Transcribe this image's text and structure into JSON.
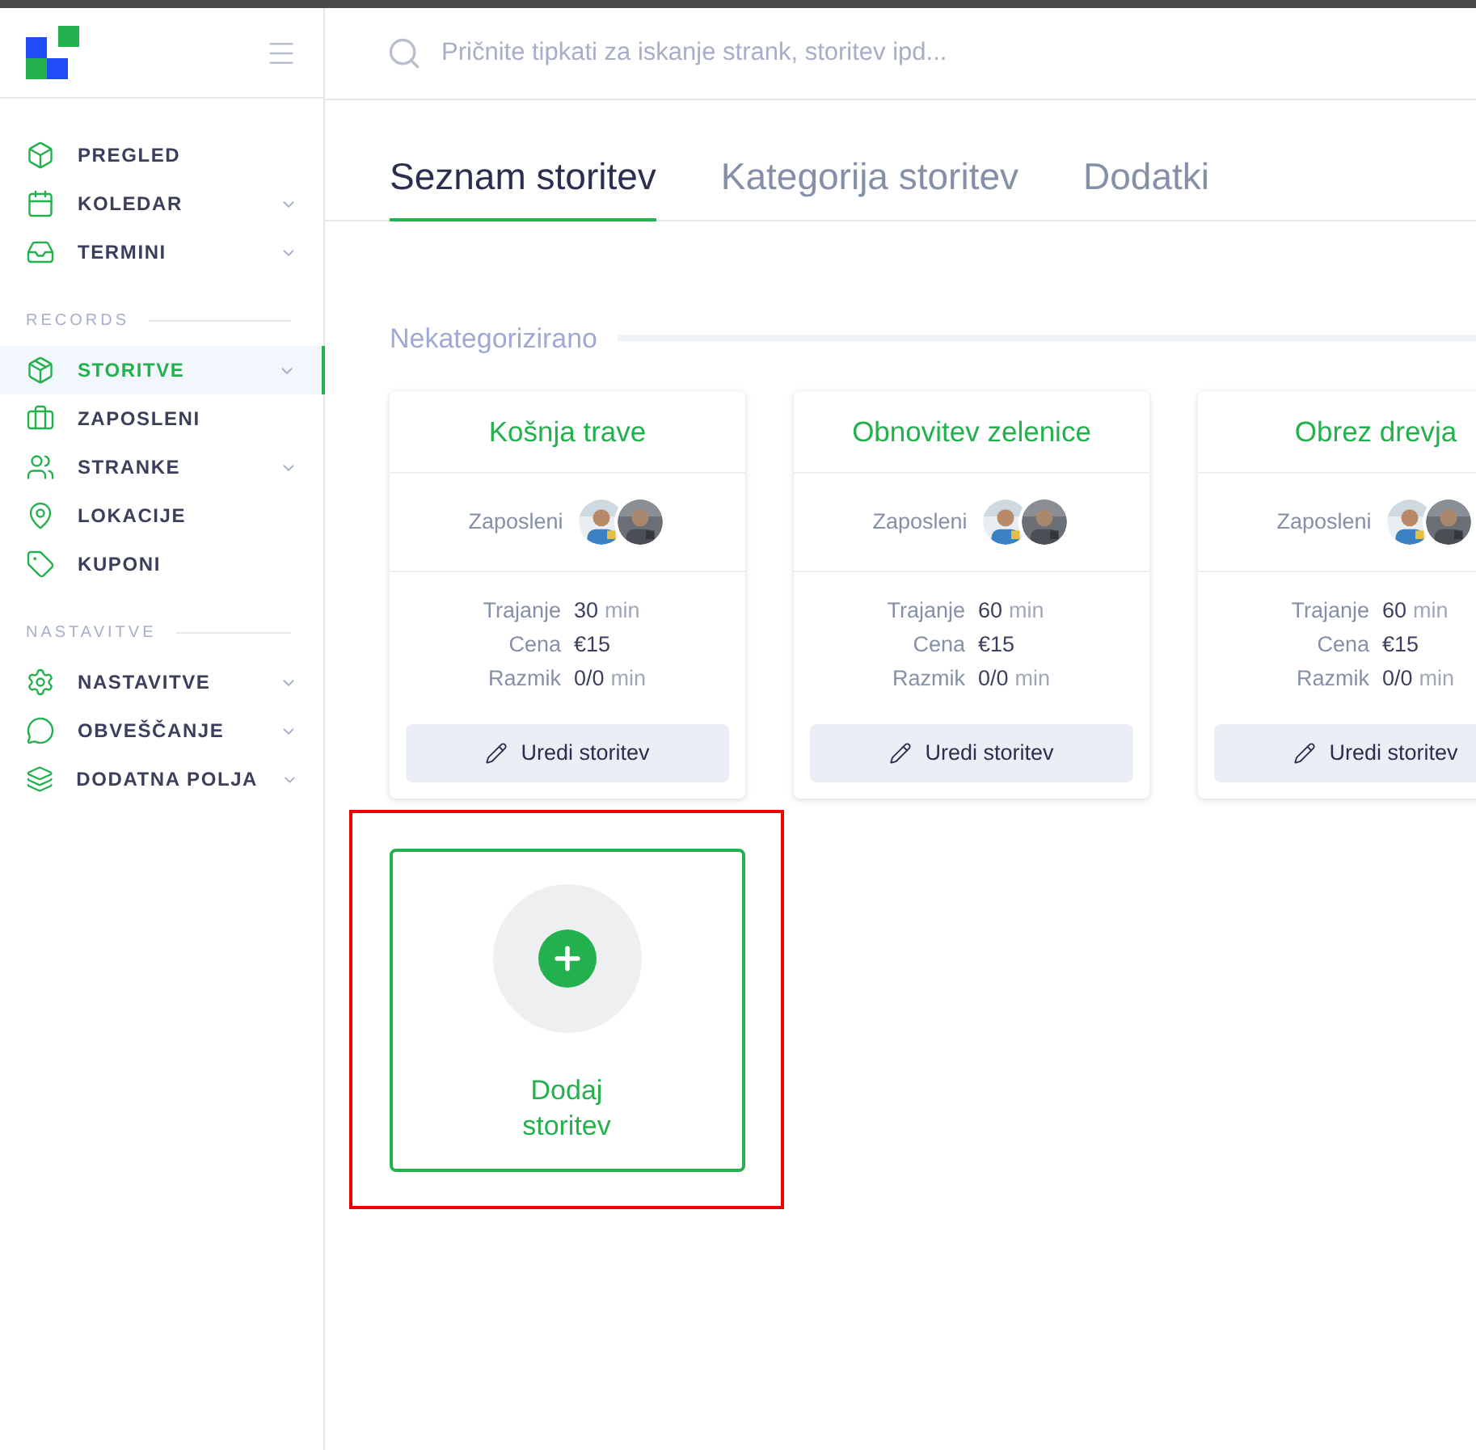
{
  "search": {
    "placeholder": "Pričnite tipkati za iskanje strank, storitev ipd..."
  },
  "sidebar": {
    "sections": [
      {
        "items": [
          {
            "label": "PREGLED",
            "selected": false,
            "expandable": false
          },
          {
            "label": "KOLEDAR",
            "selected": false,
            "expandable": true
          },
          {
            "label": "TERMINI",
            "selected": false,
            "expandable": true
          }
        ]
      },
      {
        "title": "RECORDS",
        "items": [
          {
            "label": "STORITVE",
            "selected": true,
            "expandable": true
          },
          {
            "label": "ZAPOSLENI",
            "selected": false,
            "expandable": false
          },
          {
            "label": "STRANKE",
            "selected": false,
            "expandable": true
          },
          {
            "label": "LOKACIJE",
            "selected": false,
            "expandable": false
          },
          {
            "label": "KUPONI",
            "selected": false,
            "expandable": false
          }
        ]
      },
      {
        "title": "NASTAVITVE",
        "items": [
          {
            "label": "NASTAVITVE",
            "selected": false,
            "expandable": true
          },
          {
            "label": "OBVEŠČANJE",
            "selected": false,
            "expandable": true
          },
          {
            "label": "DODATNA POLJA",
            "selected": false,
            "expandable": true
          }
        ]
      }
    ]
  },
  "tabs": [
    {
      "label": "Seznam storitev",
      "selected": true
    },
    {
      "label": "Kategorija storitev",
      "selected": false
    },
    {
      "label": "Dodatki",
      "selected": false
    }
  ],
  "category": {
    "title": "Nekategorizirano",
    "services": [
      {
        "name": "Košnja trave",
        "employees_label": "Zaposleni",
        "duration_label": "Trajanje",
        "duration": "30",
        "duration_unit": "min",
        "price_label": "Cena",
        "price": "€15",
        "gap_label": "Razmik",
        "gap": "0/0",
        "gap_unit": "min",
        "button": "Uredi storitev"
      },
      {
        "name": "Obnovitev zelenice",
        "employees_label": "Zaposleni",
        "duration_label": "Trajanje",
        "duration": "60",
        "duration_unit": "min",
        "price_label": "Cena",
        "price": "€15",
        "gap_label": "Razmik",
        "gap": "0/0",
        "gap_unit": "min",
        "button": "Uredi storitev"
      },
      {
        "name": "Obrez drevja",
        "employees_label": "Zaposleni",
        "duration_label": "Trajanje",
        "duration": "60",
        "duration_unit": "min",
        "price_label": "Cena",
        "price": "€15",
        "gap_label": "Razmik",
        "gap": "0/0",
        "gap_unit": "min",
        "button": "Uredi storitev"
      }
    ],
    "add_card": {
      "label": "Dodaj storitev",
      "highlighted": true
    }
  }
}
